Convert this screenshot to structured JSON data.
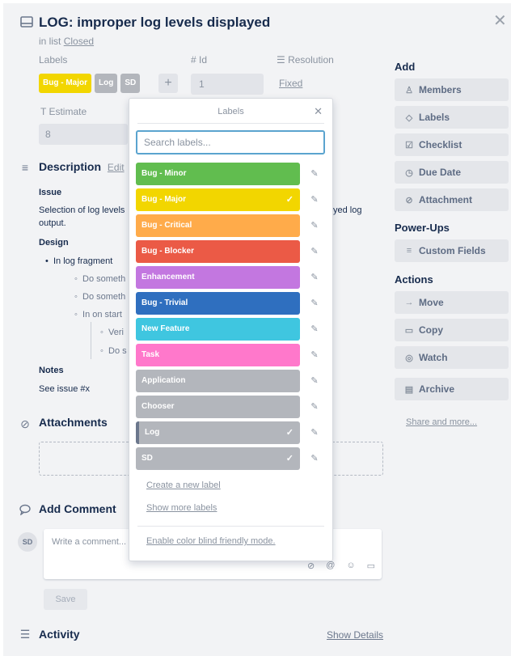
{
  "card": {
    "title": "LOG: improper log levels displayed",
    "in_list_prefix": "in list",
    "list_name": "Closed"
  },
  "fields": {
    "labels_title": "Labels",
    "id_title": "# Id",
    "id_value": "1",
    "resolution_title": "Resolution",
    "resolution_value": "Fixed",
    "estimate_title": "Estimate",
    "estimate_value": "8",
    "card_labels": [
      {
        "text": "Bug - Major",
        "color": "#f2d600"
      },
      {
        "text": "Log",
        "color": "#b3b6bc"
      },
      {
        "text": "SD",
        "color": "#b3b6bc"
      }
    ],
    "add_label_glyph": "+"
  },
  "description": {
    "title": "Description",
    "edit": "Edit",
    "issue_heading": "Issue",
    "issue_line1_a": "Selection of log levels",
    "issue_line1_b": "yed log",
    "issue_line2": "output.",
    "design_heading": "Design",
    "bullet1": "In log fragment",
    "sub1": "Do someth",
    "sub2": "Do someth",
    "sub3": "In on start",
    "subsub1": "Veri",
    "subsub2": "Do s",
    "notes_heading": "Notes",
    "notes_text": "See issue #x"
  },
  "attachments": {
    "title": "Attachments"
  },
  "comment": {
    "title": "Add Comment",
    "avatar_initials": "SD",
    "placeholder": "Write a comment...",
    "save": "Save"
  },
  "activity": {
    "title": "Activity",
    "show_details": "Show Details"
  },
  "sidebar": {
    "add_heading": "Add",
    "add_buttons": [
      {
        "label": "Members",
        "icon": "person-icon"
      },
      {
        "label": "Labels",
        "icon": "tag-icon"
      },
      {
        "label": "Checklist",
        "icon": "checkbox-icon"
      },
      {
        "label": "Due Date",
        "icon": "clock-icon"
      },
      {
        "label": "Attachment",
        "icon": "paperclip-icon"
      }
    ],
    "powerups_heading": "Power-Ups",
    "custom_fields": "Custom Fields",
    "actions_heading": "Actions",
    "action_buttons": [
      {
        "label": "Move",
        "icon": "arrow-icon"
      },
      {
        "label": "Copy",
        "icon": "copy-icon"
      },
      {
        "label": "Watch",
        "icon": "eye-icon"
      }
    ],
    "archive": "Archive",
    "share": "Share and more..."
  },
  "labels_popover": {
    "title": "Labels",
    "search_placeholder": "Search labels...",
    "items": [
      {
        "name": "Bug - Minor",
        "color": "#61bd4f",
        "selected": false
      },
      {
        "name": "Bug - Major",
        "color": "#f2d600",
        "selected": true
      },
      {
        "name": "Bug - Critical",
        "color": "#ffab4a",
        "selected": false
      },
      {
        "name": "Bug - Blocker",
        "color": "#eb5a46",
        "selected": false
      },
      {
        "name": "Enhancement",
        "color": "#c377e0",
        "selected": false
      },
      {
        "name": "Bug - Trivial",
        "color": "#2f6fbf",
        "selected": false
      },
      {
        "name": "New Feature",
        "color": "#3fc6e0",
        "selected": false
      },
      {
        "name": "Task",
        "color": "#ff78cb",
        "selected": false
      },
      {
        "name": "Application",
        "color": "#b3b6bc",
        "selected": false
      },
      {
        "name": "Chooser",
        "color": "#b3b6bc",
        "selected": false
      },
      {
        "name": "Log",
        "color": "#b3b6bc",
        "selected": true
      },
      {
        "name": "SD",
        "color": "#b3b6bc",
        "selected": true
      }
    ],
    "create_link": "Create a new label",
    "more_link": "Show more labels",
    "colorblind_link": "Enable color blind friendly mode."
  }
}
